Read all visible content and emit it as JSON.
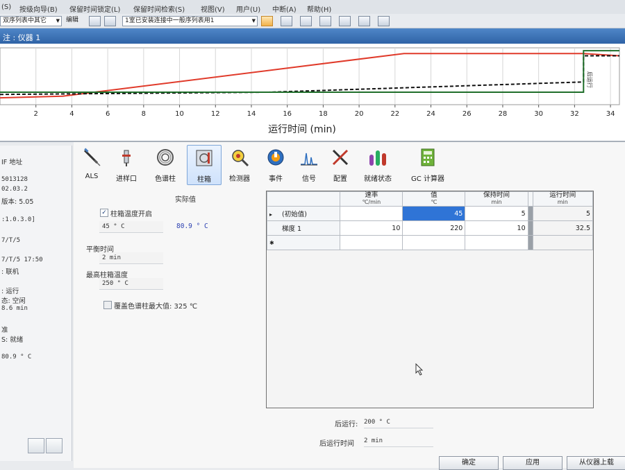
{
  "menu": [
    "(S)",
    "按级向导(B)",
    "保留时间锁定(L)",
    "保留时间检索(S)",
    "视图(V)",
    "用户(U)",
    "中断(A)",
    "帮助(H)"
  ],
  "toolbar": {
    "combo1": "双序列表中其它",
    "combo2_label": "编辑",
    "combo3": "1室已安装连接中一般序列表用1"
  },
  "window_title": "注 : 仪器 1",
  "chart_data": {
    "type": "line",
    "xlabel": "运行时间 (min)",
    "x_ticks": [
      2,
      4,
      6,
      8,
      10,
      12,
      14,
      16,
      18,
      20,
      22,
      24,
      26,
      28,
      30,
      32,
      34
    ],
    "xlim": [
      0,
      34.5
    ],
    "annotation": "后运行",
    "series": [
      {
        "color": "#e03a2a",
        "style": "solid",
        "x": [
          0,
          3.5,
          22.5,
          32.5,
          34.5
        ],
        "y": [
          0.12,
          0.15,
          0.9,
          0.9,
          0.86
        ]
      },
      {
        "color": "#111111",
        "style": "dashed",
        "x": [
          0,
          15,
          32.5,
          32.5,
          34.5
        ],
        "y": [
          0.18,
          0.22,
          0.4,
          0.86,
          0.86
        ]
      },
      {
        "color": "#1f6e2a",
        "style": "solid",
        "x": [
          0,
          32.5,
          32.5,
          34.5
        ],
        "y": [
          0.22,
          0.22,
          0.95,
          0.95
        ]
      }
    ]
  },
  "left_panel": {
    "rows": [
      "IF 地址",
      "5013128",
      "02.03.2",
      "版本:  5.05",
      ":1.0.3.0]",
      "7/T/5",
      "7/T/5 17:50",
      ":  联机",
      ":  运行",
      "态:  空闲",
      "8.6  min",
      "准",
      "S:  就绪",
      "80.9 ° C"
    ]
  },
  "tools": [
    {
      "label": "ALS",
      "icon": "syringe-icon"
    },
    {
      "label": "进样口",
      "icon": "inlet-icon"
    },
    {
      "label": "色谱柱",
      "icon": "column-coil-icon"
    },
    {
      "label": "柱箱",
      "icon": "oven-icon"
    },
    {
      "label": "检测器",
      "icon": "detector-icon"
    },
    {
      "label": "事件",
      "icon": "events-icon"
    },
    {
      "label": "信号",
      "icon": "signal-icon"
    },
    {
      "label": "配置",
      "icon": "config-tools-icon"
    },
    {
      "label": "就绪状态",
      "icon": "readiness-icon"
    },
    {
      "label": "GC 计算器",
      "icon": "calculator-icon"
    }
  ],
  "oven": {
    "actual_label": "实际值",
    "enable_label": "柱箱温度开启",
    "enabled": true,
    "setpoint": "45 ° C",
    "actual_value": "80.9 ° C",
    "equil_label": "平衡时间",
    "equil_value": "2 min",
    "max_label": "最高柱箱温度",
    "max_value": "250 ° C",
    "override_label": "覆盖色谱柱最大值: 325 ℃"
  },
  "ramp_table": {
    "headers": [
      {
        "title": "速率",
        "unit": "℃/min"
      },
      {
        "title": "值",
        "unit": "℃"
      },
      {
        "title": "保持时间",
        "unit": "min"
      },
      {
        "title": "运行时间",
        "unit": "min"
      }
    ],
    "rows": [
      {
        "marker": "▸",
        "label": "(初始值)",
        "rate": "",
        "value": "45",
        "hold": "5",
        "run": "5"
      },
      {
        "marker": "",
        "label": "梯度 1",
        "rate": "10",
        "value": "220",
        "hold": "10",
        "run": "32.5"
      },
      {
        "marker": "✱",
        "label": "",
        "rate": "",
        "value": "",
        "hold": "",
        "run": ""
      }
    ]
  },
  "post_run": {
    "temp_label": "后运行:",
    "temp_value": "200 ° C",
    "time_label": "后运行时间",
    "time_value": "2 min"
  },
  "buttons": {
    "ok": "确定",
    "apply": "应用",
    "upload": "从仪器上载"
  }
}
